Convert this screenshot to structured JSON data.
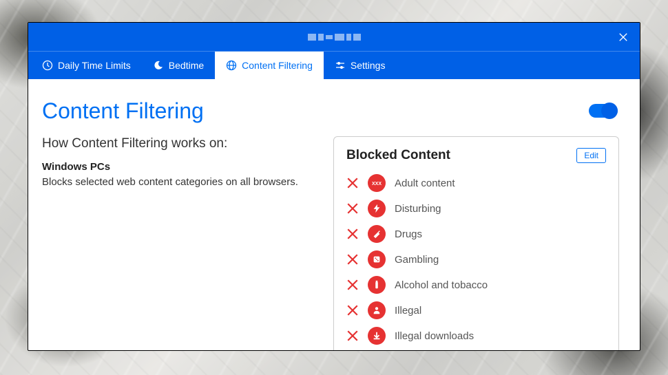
{
  "tabs": {
    "daily": "Daily Time Limits",
    "bedtime": "Bedtime",
    "content": "Content Filtering",
    "settings": "Settings"
  },
  "page": {
    "title": "Content Filtering",
    "how_works": "How Content Filtering works on:",
    "platform": "Windows PCs",
    "platform_desc": "Blocks selected web content categories on all browsers."
  },
  "blocked": {
    "title": "Blocked Content",
    "edit": "Edit",
    "items": [
      {
        "label": "Adult content",
        "icon": "xxx"
      },
      {
        "label": "Disturbing",
        "icon": "bolt"
      },
      {
        "label": "Drugs",
        "icon": "syringe"
      },
      {
        "label": "Gambling",
        "icon": "dice"
      },
      {
        "label": "Alcohol and tobacco",
        "icon": "bottle"
      },
      {
        "label": "Illegal",
        "icon": "person"
      },
      {
        "label": "Illegal downloads",
        "icon": "download"
      }
    ]
  }
}
